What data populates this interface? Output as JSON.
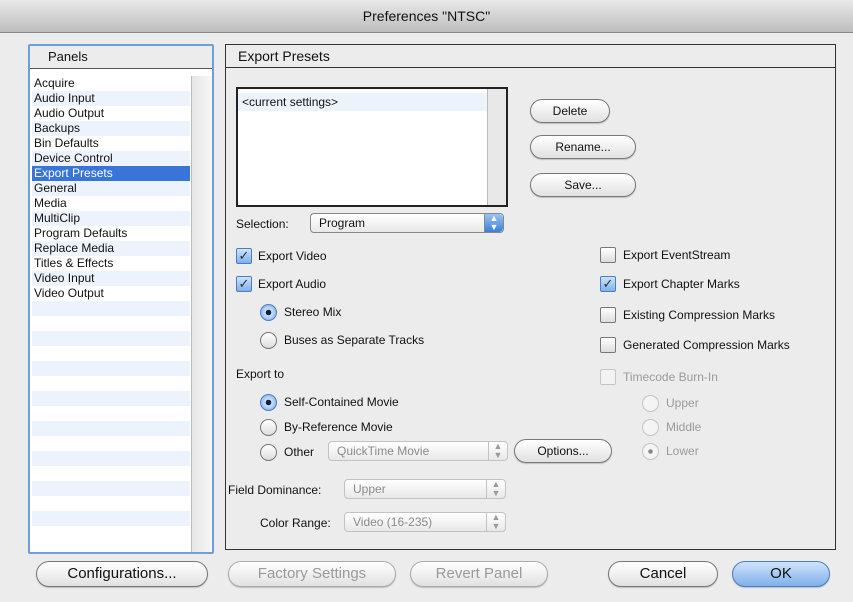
{
  "window": {
    "title": "Preferences \"NTSC\""
  },
  "panels": {
    "header": "Panels",
    "items": [
      "Acquire",
      "Audio Input",
      "Audio Output",
      "Backups",
      "Bin Defaults",
      "Device Control",
      "Export Presets",
      "General",
      "Media",
      "MultiClip",
      "Program Defaults",
      "Replace Media",
      "Titles & Effects",
      "Video Input",
      "Video Output"
    ],
    "selected": "Export Presets"
  },
  "export_presets": {
    "header": "Export Presets",
    "list": [
      "<current settings>"
    ],
    "buttons": {
      "delete": "Delete",
      "rename": "Rename...",
      "save": "Save..."
    },
    "selection": {
      "label": "Selection:",
      "value": "Program"
    },
    "export_video": {
      "label": "Export Video",
      "checked": true
    },
    "export_audio": {
      "label": "Export Audio",
      "checked": true
    },
    "audio_mode": {
      "stereo_mix": "Stereo Mix",
      "buses": "Buses as Separate Tracks",
      "selected": "Stereo Mix"
    },
    "export_to": {
      "label": "Export to",
      "self_contained": "Self-Contained Movie",
      "by_reference": "By-Reference Movie",
      "other": "Other",
      "other_format": "QuickTime Movie",
      "selected": "Self-Contained Movie",
      "options_button": "Options..."
    },
    "field_dominance": {
      "label": "Field Dominance:",
      "value": "Upper"
    },
    "color_range": {
      "label": "Color Range:",
      "value": "Video (16-235)"
    },
    "right_options": {
      "eventstream": {
        "label": "Export EventStream",
        "checked": false
      },
      "chapter_marks": {
        "label": "Export Chapter Marks",
        "checked": true
      },
      "existing_compression": {
        "label": "Existing Compression  Marks",
        "checked": false
      },
      "generated_compression": {
        "label": "Generated Compression Marks",
        "checked": false
      },
      "timecode_burn": {
        "label": "Timecode Burn-In",
        "checked": false,
        "enabled": false
      },
      "position": {
        "upper": "Upper",
        "middle": "Middle",
        "lower": "Lower",
        "selected": "Lower"
      }
    }
  },
  "bottom": {
    "configurations": "Configurations...",
    "factory_settings": "Factory Settings",
    "revert_panel": "Revert Panel",
    "cancel": "Cancel",
    "ok": "OK"
  }
}
